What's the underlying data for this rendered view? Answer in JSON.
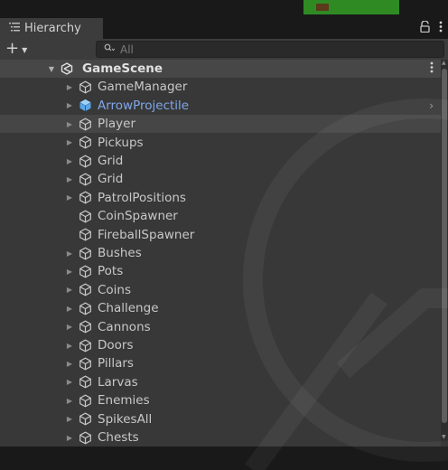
{
  "window": {
    "tab_title": "Hierarchy"
  },
  "toolbar": {
    "search_placeholder": "All"
  },
  "scene": {
    "name": "GameScene"
  },
  "objects": [
    {
      "name": "GameManager",
      "expandable": true,
      "type": "gameobject"
    },
    {
      "name": "ArrowProjectile",
      "expandable": true,
      "type": "prefab"
    },
    {
      "name": "Player",
      "expandable": true,
      "type": "gameobject",
      "selected": true
    },
    {
      "name": "Pickups",
      "expandable": true,
      "type": "gameobject"
    },
    {
      "name": "Grid",
      "expandable": true,
      "type": "gameobject"
    },
    {
      "name": "Grid",
      "expandable": true,
      "type": "gameobject"
    },
    {
      "name": "PatrolPositions",
      "expandable": true,
      "type": "gameobject"
    },
    {
      "name": "CoinSpawner",
      "expandable": false,
      "type": "gameobject"
    },
    {
      "name": "FireballSpawner",
      "expandable": false,
      "type": "gameobject"
    },
    {
      "name": "Bushes",
      "expandable": true,
      "type": "gameobject"
    },
    {
      "name": "Pots",
      "expandable": true,
      "type": "gameobject"
    },
    {
      "name": "Coins",
      "expandable": true,
      "type": "gameobject"
    },
    {
      "name": "Challenge",
      "expandable": true,
      "type": "gameobject"
    },
    {
      "name": "Cannons",
      "expandable": true,
      "type": "gameobject"
    },
    {
      "name": "Doors",
      "expandable": true,
      "type": "gameobject"
    },
    {
      "name": "Pillars",
      "expandable": true,
      "type": "gameobject"
    },
    {
      "name": "Larvas",
      "expandable": true,
      "type": "gameobject"
    },
    {
      "name": "Enemies",
      "expandable": true,
      "type": "gameobject"
    },
    {
      "name": "SpikesAll",
      "expandable": true,
      "type": "gameobject"
    },
    {
      "name": "Chests",
      "expandable": true,
      "type": "gameobject"
    }
  ],
  "colors": {
    "prefab_text": "#7fa7ea",
    "prefab_icon": "#5aa7e8",
    "panel_bg": "#383838",
    "scene_row_bg": "#474747"
  },
  "icons": {
    "hierarchy": "list-icon",
    "lock": "lock-icon",
    "menu": "kebab-menu-icon",
    "add": "plus-icon",
    "search": "search-icon",
    "scene": "unity-scene-icon",
    "gameobject": "cube-outline-icon",
    "prefab": "cube-filled-icon"
  }
}
